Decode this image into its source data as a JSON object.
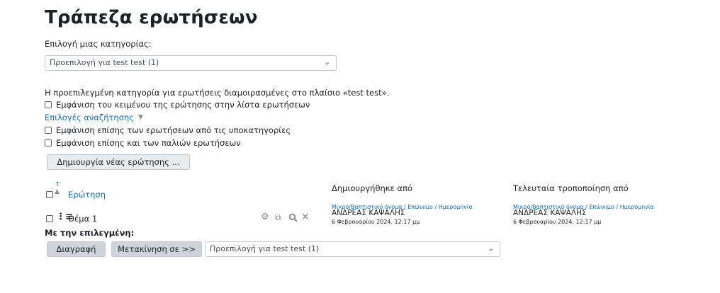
{
  "page": {
    "title": "Τράπεζα ερωτήσεων",
    "category_label": "Επιλογή μιας κατηγορίας:",
    "category_select": "Προεπιλογή για test test (1)",
    "category_info": "Η προεπιλεγμένη κατηγορία για ερωτήσεις διαμοιρασμένες στο πλαίσιο «test test».",
    "show_text_label": "Εμφάνιση του κειμένου της ερώτησης στην λίστα ερωτήσεων",
    "search_options_label": "Επιλογές αναζήτησης",
    "subcategories_label": "Εμφάνιση επίσης των ερωτήσεων από τις υποκατηγορίες",
    "old_questions_label": "Εμφάνιση επίσης και των παλιών ερωτήσεων",
    "create_button": "Δημιουργία νέας ερώτησης ..."
  },
  "table": {
    "type_sort_letter": "T",
    "question_header": "Ερώτηση",
    "created_by_header": "Δημιουργήθηκε από",
    "modified_by_header": "Τελευταία τροποποίηση από",
    "sub_first": "Μικρό/Βαπτιστικό όνομα",
    "sub_sep1": " / ",
    "sub_last": "Επώνυμο",
    "sub_sep2": " / ",
    "sub_date": "Ημερομηνία",
    "rows": [
      {
        "name": "Θέμα 1",
        "created_name": "ΑΝΔΡΕΑΣ ΚΑΨΑΛΗΣ",
        "created_date": "6 Φεβρουαρίου 2024, 12:17 μμ",
        "modified_name": "ΑΝΔΡΕΑΣ ΚΑΨΑΛΗΣ",
        "modified_date": "6 Φεβρουαρίου 2024, 12:17 μμ"
      }
    ]
  },
  "bulk": {
    "label": "Με την επιλεγμένη:",
    "delete_button": "Διαγραφή",
    "move_button": "Μετακίνηση σε >>",
    "move_select": "Προεπιλογή για test test (1)"
  },
  "icons": {
    "select_chevron": "chevron-down-icon",
    "search_options_caret": "caret-down-icon",
    "sort": "sort-up-icon",
    "qtype": "multichoice-icon",
    "edit": "gear-icon",
    "duplicate": "duplicate-icon",
    "preview": "search-icon",
    "delete": "close-icon"
  }
}
